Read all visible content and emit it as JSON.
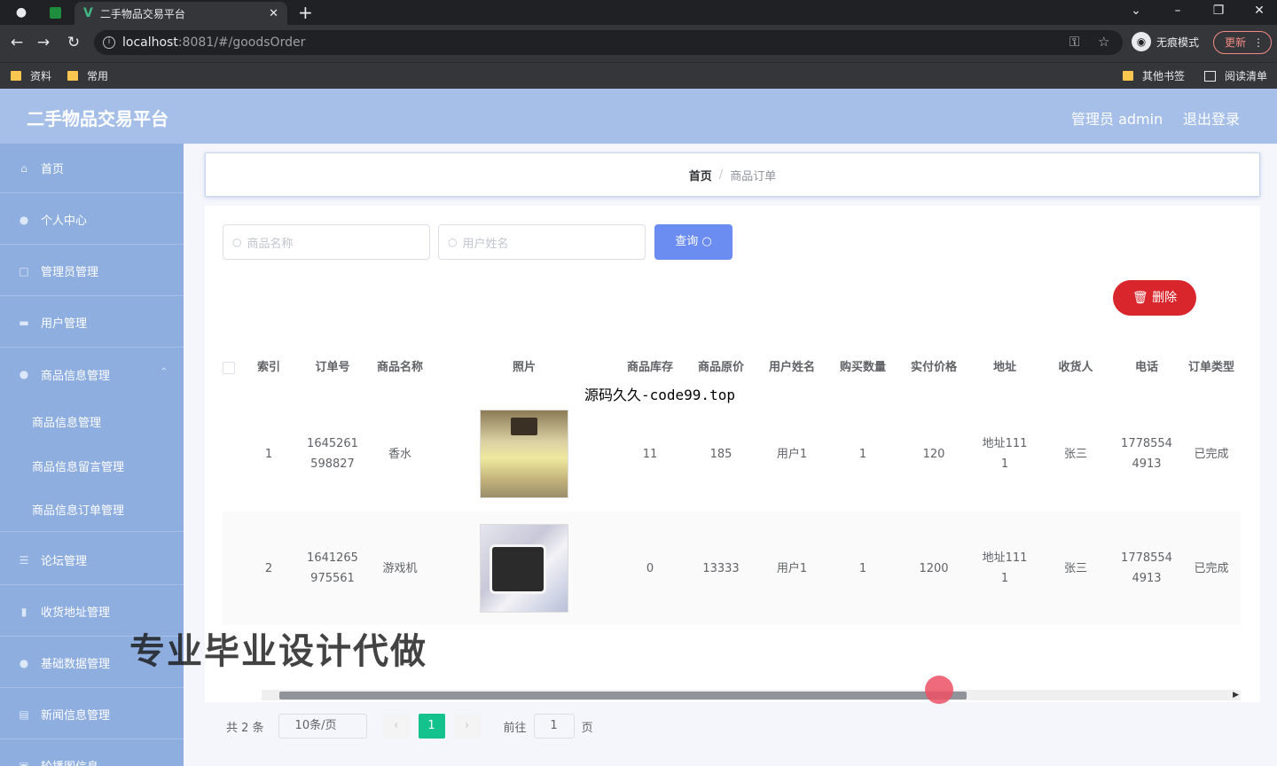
{
  "browser": {
    "tab_title": "二手物品交易平台",
    "url_host": "localhost",
    "url_rest": ":8081/#/goodsOrder",
    "incognito_label": "无痕模式",
    "update_label": "更新",
    "bookmarks": [
      "资料",
      "常用"
    ],
    "other_bookmarks": "其他书签",
    "reading_list": "阅读清单"
  },
  "header": {
    "title": "二手物品交易平台",
    "admin": "管理员 admin",
    "logout": "退出登录"
  },
  "sidebar": {
    "items": [
      {
        "label": "首页",
        "icon": "home-icon"
      },
      {
        "label": "个人中心",
        "icon": "user-icon"
      },
      {
        "label": "管理员管理",
        "icon": "square-icon"
      },
      {
        "label": "用户管理",
        "icon": "users-icon"
      },
      {
        "label": "商品信息管理",
        "icon": "user-icon"
      },
      {
        "label": "论坛管理",
        "icon": "menu-icon"
      },
      {
        "label": "收货地址管理",
        "icon": "chart-icon"
      },
      {
        "label": "基础数据管理",
        "icon": "user-icon"
      },
      {
        "label": "新闻信息管理",
        "icon": "doc-icon"
      },
      {
        "label": "轮播图信息",
        "icon": "image-icon"
      }
    ],
    "sub_items": [
      "商品信息管理",
      "商品信息留言管理",
      "商品信息订单管理"
    ]
  },
  "breadcrumb": {
    "home": "首页",
    "separator": "/",
    "current": "商品订单"
  },
  "search": {
    "goods_name_placeholder": "商品名称",
    "user_name_placeholder": "用户姓名",
    "query_label": "查询"
  },
  "actions": {
    "delete_label": "删除"
  },
  "overlay_text": "源码久久-code99.top",
  "table": {
    "headers": [
      "索引",
      "订单号",
      "商品名称",
      "照片",
      "商品库存",
      "商品原价",
      "用户姓名",
      "购买数量",
      "实付价格",
      "地址",
      "收货人",
      "电话",
      "订单类型"
    ],
    "rows": [
      {
        "index": "1",
        "order_no_1": "1645261",
        "order_no_2": "598827",
        "goods_name": "香水",
        "photo": "perfume-photo",
        "stock": "11",
        "price": "185",
        "user": "用户1",
        "qty": "1",
        "paid": "120",
        "addr_1": "地址111",
        "addr_2": "1",
        "receiver": "张三",
        "phone_1": "1778554",
        "phone_2": "4913",
        "type": "已完成"
      },
      {
        "index": "2",
        "order_no_1": "1641265",
        "order_no_2": "975561",
        "goods_name": "游戏机",
        "photo": "console-photo",
        "stock": "0",
        "price": "13333",
        "user": "用户1",
        "qty": "1",
        "paid": "1200",
        "addr_1": "地址111",
        "addr_2": "1",
        "receiver": "张三",
        "phone_1": "1778554",
        "phone_2": "4913",
        "type": "已完成"
      }
    ]
  },
  "pager": {
    "total": "共 2 条",
    "page_size": "10条/页",
    "current_page": "1",
    "goto_prefix": "前往",
    "goto_value": "1",
    "goto_suffix": "页"
  },
  "banner_text": "专业毕业设计代做",
  "colors": {
    "header": "#a5bfe8",
    "sidebar": "#8eaee0",
    "query_button": "#6b8cf0",
    "delete_button": "#d8262c",
    "active_page": "#13c28d"
  }
}
